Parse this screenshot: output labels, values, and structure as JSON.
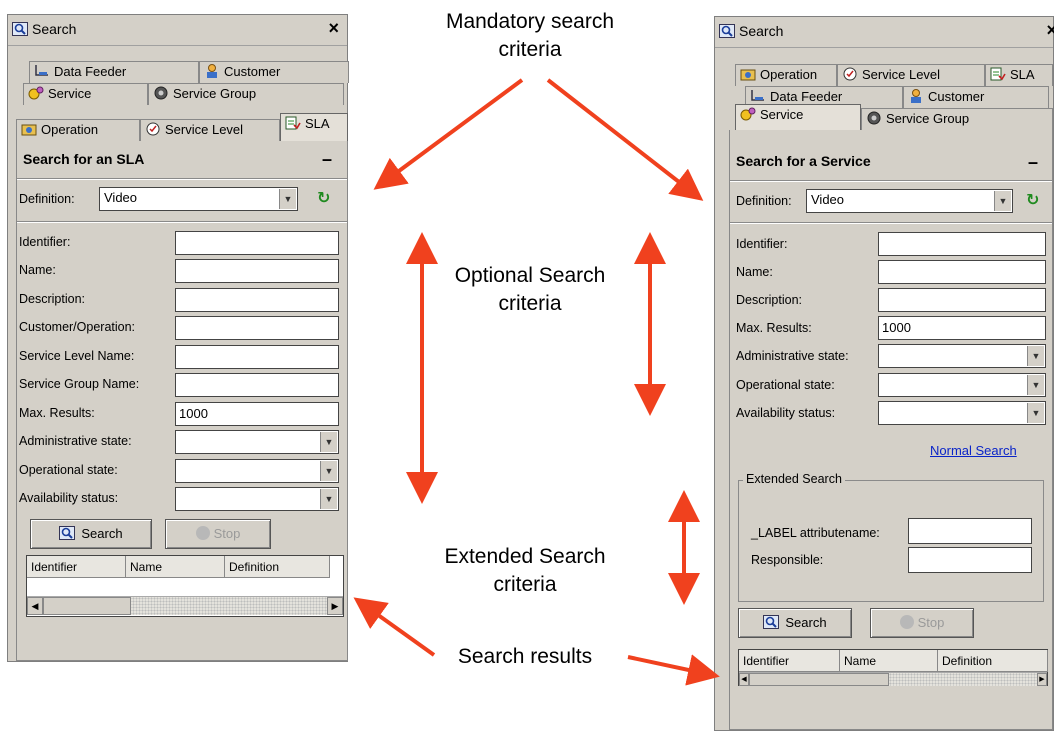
{
  "annotations": {
    "mandatory": [
      "Mandatory search",
      "criteria"
    ],
    "optional": [
      "Optional Search",
      "criteria"
    ],
    "extended": [
      "Extended Search",
      "criteria"
    ],
    "results": "Search results"
  },
  "left_panel": {
    "title": "Search",
    "close": "×",
    "tabs_row1": [
      "Data Feeder",
      "Customer"
    ],
    "tabs_row2": [
      "Service",
      "Service Group"
    ],
    "tabs_row3": [
      "Operation",
      "Service Level",
      "SLA"
    ],
    "section_title": "Search for an SLA",
    "collapse": "–",
    "definition_label": "Definition:",
    "definition_value": "Video",
    "fields": [
      "Identifier:",
      "Name:",
      "Description:",
      "Customer/Operation:",
      "Service Level Name:",
      "Service Group Name:",
      "Max. Results:"
    ],
    "max_results": "1000",
    "selects": [
      "Administrative state:",
      "Operational state:",
      "Availability status:"
    ],
    "search_button": "Search",
    "stop_button": "Stop",
    "columns": [
      "Identifier",
      "Name",
      "Definition"
    ]
  },
  "right_panel": {
    "title": "Search",
    "close": "×",
    "tabs_row1": [
      "Operation",
      "Service Level",
      "SLA"
    ],
    "tabs_row2": [
      "Data Feeder",
      "Customer"
    ],
    "tabs_row3": [
      "Service",
      "Service Group"
    ],
    "section_title": "Search for a Service",
    "collapse": "–",
    "definition_label": "Definition:",
    "definition_value": "Video",
    "fields": [
      "Identifier:",
      "Name:",
      "Description:",
      "Max. Results:"
    ],
    "max_results": "1000",
    "selects": [
      "Administrative state:",
      "Operational state:",
      "Availability status:"
    ],
    "normal_search_link": "Normal Search",
    "extended_group_title": "Extended Search",
    "extended_fields": [
      "_LABEL attributename:",
      "Responsible:"
    ],
    "search_button": "Search",
    "stop_button": "Stop",
    "columns": [
      "Identifier",
      "Name",
      "Definition"
    ]
  },
  "colors": {
    "arrow": "#f0411e",
    "panel": "#d4d0c8",
    "link": "#0a24c8"
  }
}
